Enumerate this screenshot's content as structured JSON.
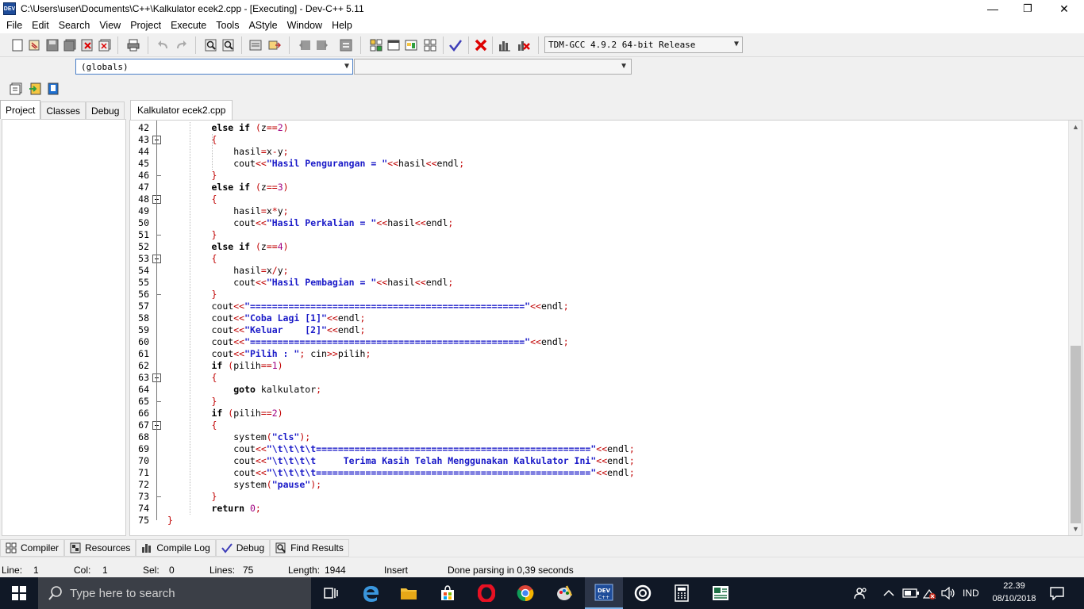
{
  "window": {
    "title": "C:\\Users\\user\\Documents\\C++\\Kalkulator ecek2.cpp - [Executing] - Dev-C++ 5.11",
    "app_icon_text": "DEV",
    "minimize": "—",
    "maximize": "❐",
    "close": "✕"
  },
  "menu": [
    "File",
    "Edit",
    "Search",
    "View",
    "Project",
    "Execute",
    "Tools",
    "AStyle",
    "Window",
    "Help"
  ],
  "toolbar": {
    "compiler": "TDM-GCC 4.9.2 64-bit Release",
    "scope": "(globals)",
    "member": ""
  },
  "left_tabs": [
    "Project",
    "Classes",
    "Debug"
  ],
  "editor_tab": "Kalkulator ecek2.cpp",
  "code": [
    {
      "n": "42",
      "fold": false
    },
    {
      "n": "43",
      "fold": true
    },
    {
      "n": "44",
      "fold": false
    },
    {
      "n": "45",
      "fold": false
    },
    {
      "n": "46",
      "fold": false
    },
    {
      "n": "47",
      "fold": false
    },
    {
      "n": "48",
      "fold": true
    },
    {
      "n": "49",
      "fold": false
    },
    {
      "n": "50",
      "fold": false
    },
    {
      "n": "51",
      "fold": false
    },
    {
      "n": "52",
      "fold": false
    },
    {
      "n": "53",
      "fold": true
    },
    {
      "n": "54",
      "fold": false
    },
    {
      "n": "55",
      "fold": false
    },
    {
      "n": "56",
      "fold": false
    },
    {
      "n": "57",
      "fold": false
    },
    {
      "n": "58",
      "fold": false
    },
    {
      "n": "59",
      "fold": false
    },
    {
      "n": "60",
      "fold": false
    },
    {
      "n": "61",
      "fold": false
    },
    {
      "n": "62",
      "fold": false
    },
    {
      "n": "63",
      "fold": true
    },
    {
      "n": "64",
      "fold": false
    },
    {
      "n": "65",
      "fold": false
    },
    {
      "n": "66",
      "fold": false
    },
    {
      "n": "67",
      "fold": true
    },
    {
      "n": "68",
      "fold": false
    },
    {
      "n": "69",
      "fold": false
    },
    {
      "n": "70",
      "fold": false
    },
    {
      "n": "71",
      "fold": false
    },
    {
      "n": "72",
      "fold": false
    },
    {
      "n": "73",
      "fold": false
    },
    {
      "n": "74",
      "fold": false
    },
    {
      "n": "75",
      "fold": false
    }
  ],
  "code_text": [
    "        else if (z==2)",
    "        {",
    "            hasil=x-y;",
    "            cout<<\"Hasil Pengurangan = \"<<hasil<<endl;",
    "        }",
    "        else if (z==3)",
    "        {",
    "            hasil=x*y;",
    "            cout<<\"Hasil Perkalian = \"<<hasil<<endl;",
    "        }",
    "        else if (z==4)",
    "        {",
    "            hasil=x/y;",
    "            cout<<\"Hasil Pembagian = \"<<hasil<<endl;",
    "        }",
    "        cout<<\"==================================================\"<<endl;",
    "        cout<<\"Coba Lagi [1]\"<<endl;",
    "        cout<<\"Keluar    [2]\"<<endl;",
    "        cout<<\"==================================================\"<<endl;",
    "        cout<<\"Pilih : \"; cin>>pilih;",
    "        if (pilih==1)",
    "        {",
    "            goto kalkulator;",
    "        }",
    "        if (pilih==2)",
    "        {",
    "            system(\"cls\");",
    "            cout<<\"\\t\\t\\t\\t==================================================\"<<endl;",
    "            cout<<\"\\t\\t\\t\\t     Terima Kasih Telah Menggunakan Kalkulator Ini\"<<endl;",
    "            cout<<\"\\t\\t\\t\\t==================================================\"<<endl;",
    "            system(\"pause\");",
    "        }",
    "        return 0;",
    "}"
  ],
  "bottom_tabs": [
    {
      "label": "Compiler",
      "icon": "grid-icon"
    },
    {
      "label": "Resources",
      "icon": "resources-icon"
    },
    {
      "label": "Compile Log",
      "icon": "chart-icon"
    },
    {
      "label": "Debug",
      "icon": "check-icon"
    },
    {
      "label": "Find Results",
      "icon": "find-icon"
    }
  ],
  "status": {
    "line_label": "Line:",
    "line": "1",
    "col_label": "Col:",
    "col": "1",
    "sel_label": "Sel:",
    "sel": "0",
    "lines_label": "Lines:",
    "lines": "75",
    "length_label": "Length:",
    "length": "1944",
    "mode": "Insert",
    "message": "Done parsing in 0,39 seconds"
  },
  "taskbar": {
    "search_placeholder": "Type here to search",
    "language": "IND",
    "time": "22.39",
    "date": "08/10/2018"
  }
}
